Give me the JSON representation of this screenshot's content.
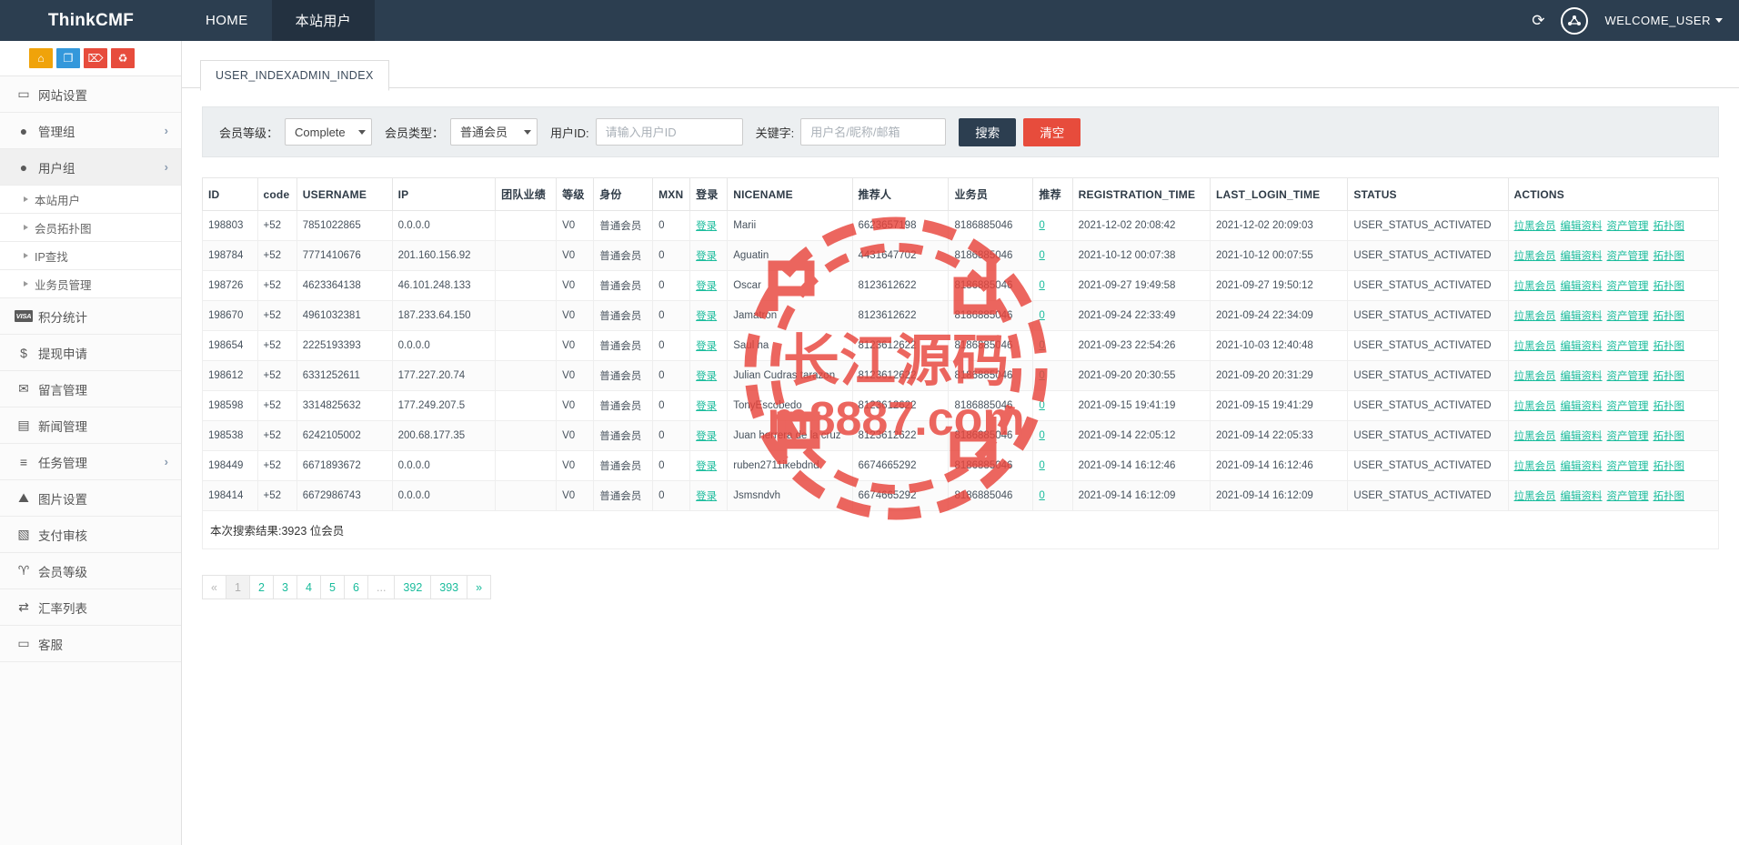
{
  "topbar": {
    "brand": "ThinkCMF",
    "nav": [
      {
        "label": "HOME",
        "active": false
      },
      {
        "label": "本站用户",
        "active": true
      }
    ],
    "refresh_icon": "refresh-icon",
    "globe_icon": "globe-icon",
    "welcome": "WELCOME_USER"
  },
  "sidebar": {
    "quick_actions": [
      {
        "name": "home-icon",
        "glyph": "⌂",
        "color": "orange"
      },
      {
        "name": "file-icon",
        "glyph": "❐",
        "color": "blue"
      },
      {
        "name": "trash-icon",
        "glyph": "⌦",
        "color": "red"
      },
      {
        "name": "recycle-icon",
        "glyph": "♻",
        "color": "red"
      }
    ],
    "items": [
      {
        "label": "网站设置",
        "icon": "monitor-icon",
        "glyph": "▭",
        "arrow": false,
        "active": false
      },
      {
        "label": "管理组",
        "icon": "user-circle-icon",
        "glyph": "●",
        "arrow": true,
        "active": false
      },
      {
        "label": "用户组",
        "icon": "user-filled-icon",
        "glyph": "●",
        "arrow": true,
        "active": true
      }
    ],
    "sub_items": [
      {
        "label": "本站用户"
      },
      {
        "label": "会员拓扑图"
      },
      {
        "label": "IP查找"
      },
      {
        "label": "业务员管理"
      }
    ],
    "items_lower": [
      {
        "label": "积分统计",
        "icon": "visa-icon",
        "glyph": "VISA",
        "arrow": false
      },
      {
        "label": "提现申请",
        "icon": "dollar-icon",
        "glyph": "$",
        "arrow": false
      },
      {
        "label": "留言管理",
        "icon": "envelope-icon",
        "glyph": "✉",
        "arrow": false
      },
      {
        "label": "新闻管理",
        "icon": "newspaper-icon",
        "glyph": "▤",
        "arrow": false
      },
      {
        "label": "任务管理",
        "icon": "tasks-icon",
        "glyph": "≡",
        "arrow": true
      },
      {
        "label": "图片设置",
        "icon": "image-icon",
        "glyph": "⛰",
        "arrow": false
      },
      {
        "label": "支付审核",
        "icon": "id-card-icon",
        "glyph": "▧",
        "arrow": false
      },
      {
        "label": "会员等级",
        "icon": "vine-icon",
        "glyph": "♈",
        "arrow": false
      },
      {
        "label": "汇率列表",
        "icon": "exchange-icon",
        "glyph": "⇄",
        "arrow": false
      },
      {
        "label": "客服",
        "icon": "monitor-icon",
        "glyph": "▭",
        "arrow": false
      }
    ]
  },
  "main": {
    "tab_label": "USER_INDEXADMIN_INDEX",
    "filters": {
      "level_label": "会员等级：",
      "level_value": "Complete",
      "type_label": "会员类型：",
      "type_value": "普通会员",
      "userid_label": "用户ID:",
      "userid_placeholder": "请输入用户ID",
      "userid_value": "",
      "keyword_label": "关键字:",
      "keyword_placeholder": "用户名/昵称/邮箱",
      "keyword_value": "",
      "search_button": "搜索",
      "clear_button": "清空"
    },
    "table": {
      "columns": [
        "ID",
        "code",
        "USERNAME",
        "IP",
        "团队业绩",
        "等级",
        "身份",
        "MXN",
        "登录",
        "NICENAME",
        "推荐人",
        "业务员",
        "推荐",
        "REGISTRATION_TIME",
        "LAST_LOGIN_TIME",
        "STATUS",
        "ACTIONS"
      ],
      "login_link": "登录",
      "actions": [
        "拉黑会员",
        "编辑资料",
        "资产管理",
        "拓扑图"
      ],
      "rows": [
        {
          "id": "198803",
          "code": "+52",
          "username": "7851022865",
          "ip": "0.0.0.0",
          "team": "",
          "level": "V0",
          "identity": "普通会员",
          "mxn": "0",
          "nicename": "Marii",
          "referrer": "6623657198",
          "salesman": "8186885046",
          "recommend": "0",
          "reg_time": "2021-12-02 20:08:42",
          "last_login": "2021-12-02 20:09:03",
          "status": "USER_STATUS_ACTIVATED"
        },
        {
          "id": "198784",
          "code": "+52",
          "username": "7771410676",
          "ip": "201.160.156.92",
          "team": "",
          "level": "V0",
          "identity": "普通会员",
          "mxn": "0",
          "nicename": "Aguatin",
          "referrer": "4431647702",
          "salesman": "8186885046",
          "recommend": "0",
          "reg_time": "2021-10-12 00:07:38",
          "last_login": "2021-10-12 00:07:55",
          "status": "USER_STATUS_ACTIVATED"
        },
        {
          "id": "198726",
          "code": "+52",
          "username": "4623364138",
          "ip": "46.101.248.133",
          "team": "",
          "level": "V0",
          "identity": "普通会员",
          "mxn": "0",
          "nicename": "Oscar",
          "referrer": "8123612622",
          "salesman": "8186885046",
          "recommend": "0",
          "reg_time": "2021-09-27 19:49:58",
          "last_login": "2021-09-27 19:50:12",
          "status": "USER_STATUS_ACTIVATED"
        },
        {
          "id": "198670",
          "code": "+52",
          "username": "4961032381",
          "ip": "187.233.64.150",
          "team": "",
          "level": "V0",
          "identity": "普通会员",
          "mxn": "0",
          "nicename": "Jamatron",
          "referrer": "8123612622",
          "salesman": "8186885046",
          "recommend": "0",
          "reg_time": "2021-09-24 22:33:49",
          "last_login": "2021-09-24 22:34:09",
          "status": "USER_STATUS_ACTIVATED"
        },
        {
          "id": "198654",
          "code": "+52",
          "username": "2225193393",
          "ip": "0.0.0.0",
          "team": "",
          "level": "V0",
          "identity": "普通会员",
          "mxn": "0",
          "nicename": "Saul ha",
          "referrer": "8123612622",
          "salesman": "8186885046",
          "recommend": "0",
          "reg_time": "2021-09-23 22:54:26",
          "last_login": "2021-10-03 12:40:48",
          "status": "USER_STATUS_ACTIVATED"
        },
        {
          "id": "198612",
          "code": "+52",
          "username": "6331252611",
          "ip": "177.227.20.74",
          "team": "",
          "level": "V0",
          "identity": "普通会员",
          "mxn": "0",
          "nicename": "Julian Cudras tarazon",
          "referrer": "8123612622",
          "salesman": "8186885046",
          "recommend": "0",
          "reg_time": "2021-09-20 20:30:55",
          "last_login": "2021-09-20 20:31:29",
          "status": "USER_STATUS_ACTIVATED"
        },
        {
          "id": "198598",
          "code": "+52",
          "username": "3314825632",
          "ip": "177.249.207.5",
          "team": "",
          "level": "V0",
          "identity": "普通会员",
          "mxn": "0",
          "nicename": "TonyEscobedo",
          "referrer": "8123612622",
          "salesman": "8186885046",
          "recommend": "0",
          "reg_time": "2021-09-15 19:41:19",
          "last_login": "2021-09-15 19:41:29",
          "status": "USER_STATUS_ACTIVATED"
        },
        {
          "id": "198538",
          "code": "+52",
          "username": "6242105002",
          "ip": "200.68.177.35",
          "team": "",
          "level": "V0",
          "identity": "普通会员",
          "mxn": "0",
          "nicename": "Juan herrera de la cruz",
          "referrer": "8123612622",
          "salesman": "8186885046",
          "recommend": "0",
          "reg_time": "2021-09-14 22:05:12",
          "last_login": "2021-09-14 22:05:33",
          "status": "USER_STATUS_ACTIVATED"
        },
        {
          "id": "198449",
          "code": "+52",
          "username": "6671893672",
          "ip": "0.0.0.0",
          "team": "",
          "level": "V0",
          "identity": "普通会员",
          "mxn": "0",
          "nicename": "ruben2711ikebdnd",
          "referrer": "6674665292",
          "salesman": "8186885046",
          "recommend": "0",
          "reg_time": "2021-09-14 16:12:46",
          "last_login": "2021-09-14 16:12:46",
          "status": "USER_STATUS_ACTIVATED"
        },
        {
          "id": "198414",
          "code": "+52",
          "username": "6672986743",
          "ip": "0.0.0.0",
          "team": "",
          "level": "V0",
          "identity": "普通会员",
          "mxn": "0",
          "nicename": "Jsmsndvh",
          "referrer": "6674665292",
          "salesman": "8186885046",
          "recommend": "0",
          "reg_time": "2021-09-14 16:12:09",
          "last_login": "2021-09-14 16:12:09",
          "status": "USER_STATUS_ACTIVATED"
        }
      ],
      "summary": "本次搜索结果:3923 位会员"
    },
    "pagination": {
      "prev": "«",
      "next": "»",
      "pages": [
        "1",
        "2",
        "3",
        "4",
        "5",
        "6",
        "...",
        "392",
        "393"
      ],
      "current": "1"
    }
  },
  "watermark": {
    "text_cn": "长江源码",
    "text_url": "m8887.com",
    "color": "#e8453c"
  },
  "colors": {
    "navy": "#2c3e50",
    "teal": "#1abc9c",
    "red": "#e74c3c",
    "orange": "#f0a30a",
    "blue": "#3498db"
  }
}
